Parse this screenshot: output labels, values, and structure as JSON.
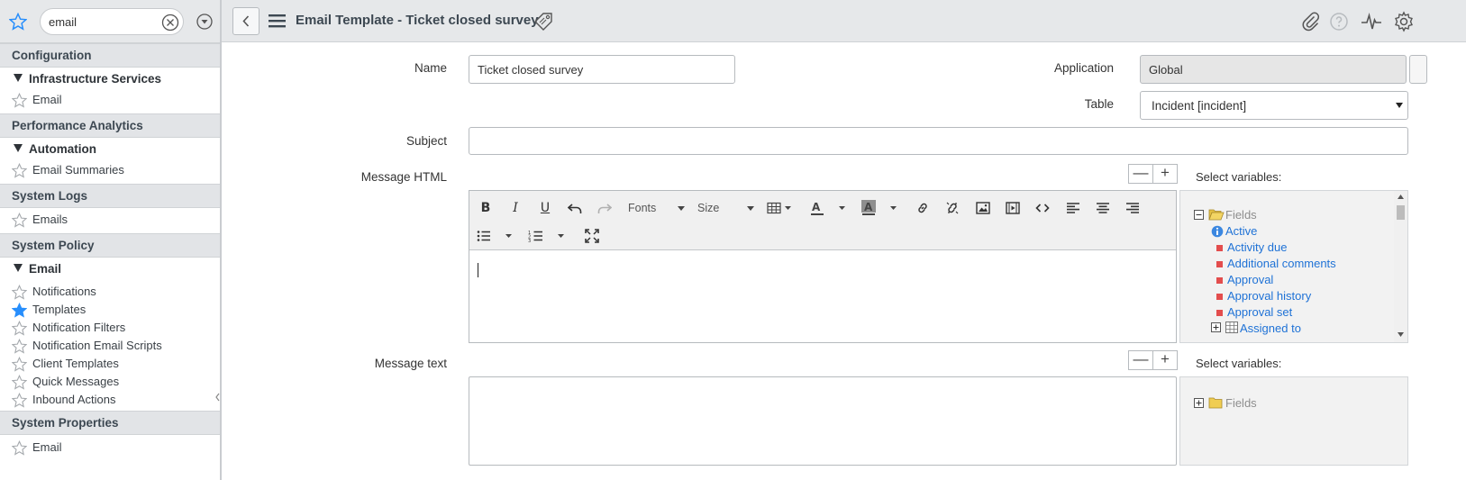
{
  "nav": {
    "filter_value": "email",
    "sections": [
      {
        "title": "Configuration"
      },
      {
        "title": "Performance Analytics"
      },
      {
        "title": "System Logs"
      },
      {
        "title": "System Policy"
      },
      {
        "title": "System Properties"
      }
    ],
    "groups": [
      {
        "title": "Infrastructure Services"
      },
      {
        "title": "Automation"
      },
      {
        "title": "Email"
      }
    ],
    "items": [
      {
        "label": "Email"
      },
      {
        "label": "Email Summaries"
      },
      {
        "label": "Emails"
      },
      {
        "label": "Notifications"
      },
      {
        "label": "Templates",
        "favorite": true
      },
      {
        "label": "Notification Filters"
      },
      {
        "label": "Notification Email Scripts"
      },
      {
        "label": "Client Templates"
      },
      {
        "label": "Quick Messages"
      },
      {
        "label": "Inbound Actions"
      },
      {
        "label": "Email"
      }
    ]
  },
  "header": {
    "title": "Email Template - Ticket closed survey"
  },
  "form": {
    "name_label": "Name",
    "name_value": "Ticket closed survey",
    "application_label": "Application",
    "application_value": "Global",
    "table_label": "Table",
    "table_value": "Incident [incident]",
    "subject_label": "Subject",
    "subject_value": "",
    "message_html_label": "Message HTML",
    "message_text_label": "Message text",
    "select_vars_label_1": "Select variables:",
    "select_vars_label_2": "Select variables:",
    "minus_symbol": "—",
    "plus_symbol": "+"
  },
  "editor": {
    "fonts_label": "Fonts",
    "size_label": "Size"
  },
  "variables": {
    "root_label": "Fields",
    "items": [
      {
        "label": "Active"
      },
      {
        "label": "Activity due"
      },
      {
        "label": "Additional comments"
      },
      {
        "label": "Approval"
      },
      {
        "label": "Approval history"
      },
      {
        "label": "Approval set"
      },
      {
        "label": "Assigned to"
      }
    ],
    "text_root_label": "Fields"
  },
  "colors": {
    "accent": "#278efc",
    "link": "#1f72d6",
    "header_bg": "#e6e8ea",
    "section_bg": "#e2e4e7"
  }
}
